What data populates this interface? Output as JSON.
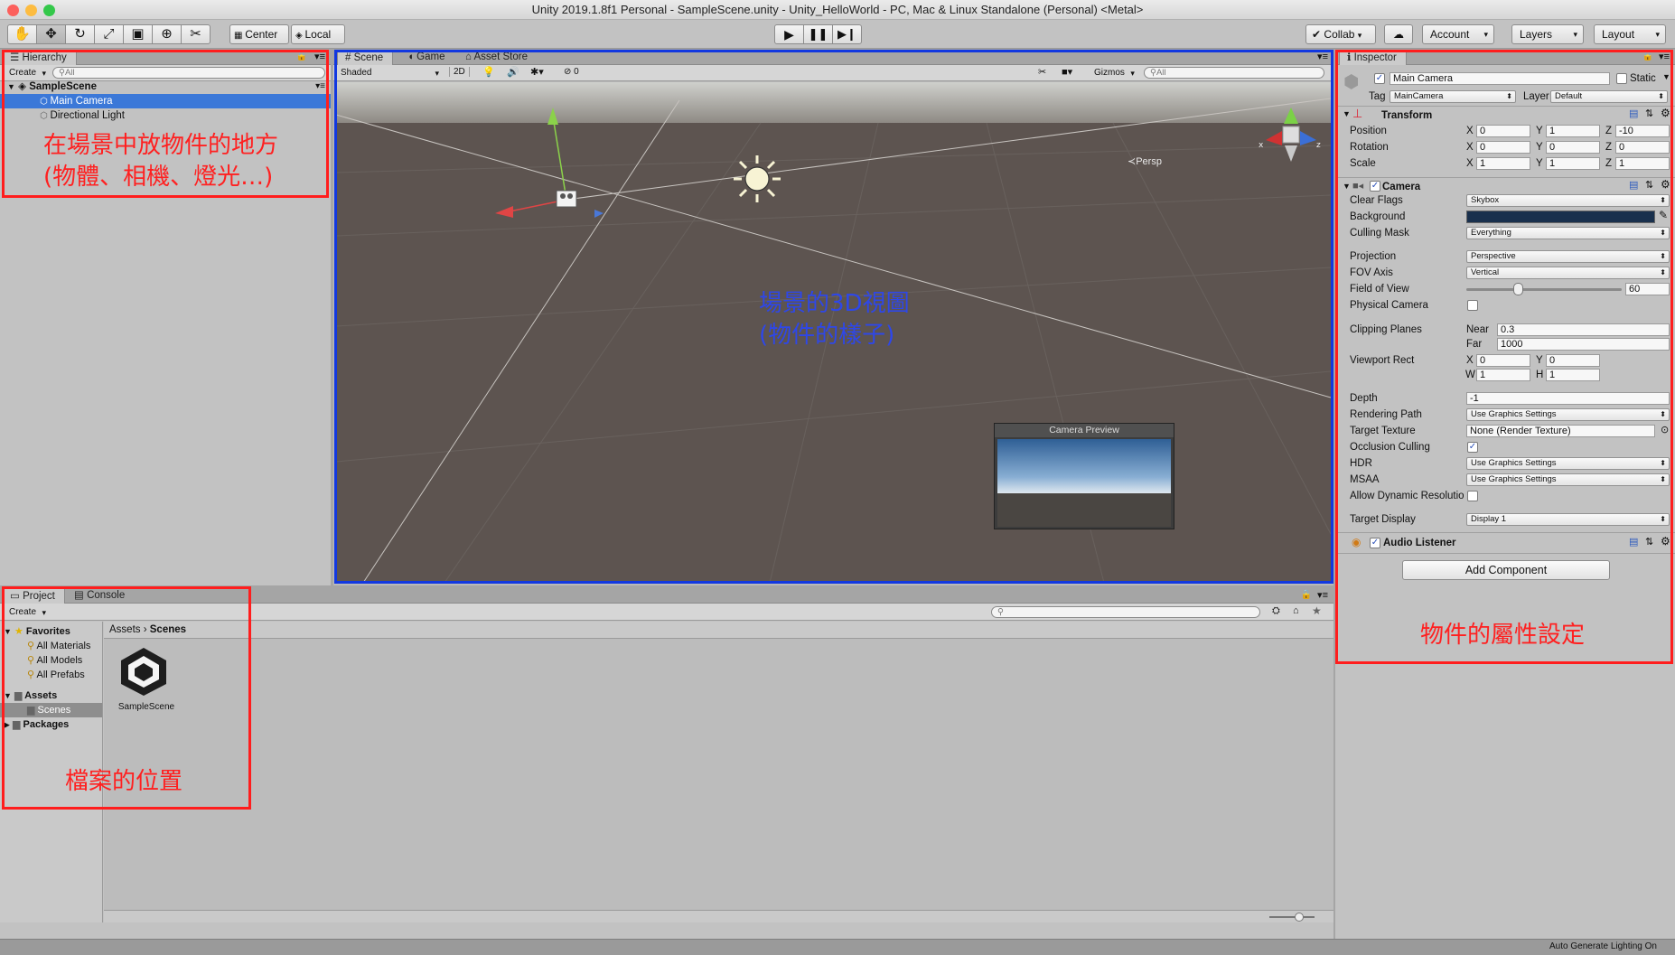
{
  "window": {
    "title": "Unity 2019.1.8f1 Personal - SampleScene.unity - Unity_HelloWorld - PC, Mac & Linux Standalone (Personal) <Metal>"
  },
  "toolbar": {
    "pivot_label": "Center",
    "space_label": "Local",
    "collab_label": "Collab",
    "account_label": "Account",
    "layers_label": "Layers",
    "layout_label": "Layout"
  },
  "hierarchy": {
    "tab_label": "Hierarchy",
    "create_label": "Create",
    "search_placeholder": "All",
    "scene_name": "SampleScene",
    "items": [
      {
        "label": "Main Camera"
      },
      {
        "label": "Directional Light"
      }
    ],
    "annotation_line1": "在場景中放物件的地方",
    "annotation_line2": "(物體、相機、燈光…)"
  },
  "scene": {
    "tabs": [
      {
        "label": "Scene"
      },
      {
        "label": "Game"
      },
      {
        "label": "Asset Store"
      }
    ],
    "shading_mode": "Shaded",
    "mode_2d": "2D",
    "hidden_count": "0",
    "gizmos_label": "Gizmos",
    "search_placeholder": "All",
    "persp_label": "Persp",
    "camera_preview_title": "Camera Preview",
    "annotation_line1": "場景的3D視圖",
    "annotation_line2": "(物件的樣子)",
    "colors": {
      "sky": "#8e8a84",
      "ground": "#5d5450"
    }
  },
  "inspector": {
    "tab_label": "Inspector",
    "object_name": "Main Camera",
    "static_label": "Static",
    "tag_label": "Tag",
    "tag_value": "MainCamera",
    "layer_label": "Layer",
    "layer_value": "Default",
    "transform": {
      "title": "Transform",
      "position_label": "Position",
      "rotation_label": "Rotation",
      "scale_label": "Scale",
      "position": {
        "x": "0",
        "y": "1",
        "z": "-10"
      },
      "rotation": {
        "x": "0",
        "y": "0",
        "z": "0"
      },
      "scale": {
        "x": "1",
        "y": "1",
        "z": "1"
      }
    },
    "camera": {
      "title": "Camera",
      "clear_flags_label": "Clear Flags",
      "clear_flags_value": "Skybox",
      "background_label": "Background",
      "background_color": "#19304d",
      "culling_mask_label": "Culling Mask",
      "culling_mask_value": "Everything",
      "projection_label": "Projection",
      "projection_value": "Perspective",
      "fov_axis_label": "FOV Axis",
      "fov_axis_value": "Vertical",
      "fov_label": "Field of View",
      "fov_value": "60",
      "fov_fraction": 0.33,
      "physical_camera_label": "Physical Camera",
      "clipping_label": "Clipping Planes",
      "near_label": "Near",
      "near_value": "0.3",
      "far_label": "Far",
      "far_value": "1000",
      "viewport_label": "Viewport Rect",
      "viewport": {
        "x": "0",
        "y": "0",
        "w": "1",
        "h": "1"
      },
      "depth_label": "Depth",
      "depth_value": "-1",
      "rendering_path_label": "Rendering Path",
      "rendering_path_value": "Use Graphics Settings",
      "target_texture_label": "Target Texture",
      "target_texture_value": "None (Render Texture)",
      "occlusion_label": "Occlusion Culling",
      "hdr_label": "HDR",
      "hdr_value": "Use Graphics Settings",
      "msaa_label": "MSAA",
      "msaa_value": "Use Graphics Settings",
      "dynamic_res_label": "Allow Dynamic Resolution",
      "target_display_label": "Target Display",
      "target_display_value": "Display 1"
    },
    "audio_listener_title": "Audio Listener",
    "add_component_label": "Add Component",
    "annotation": "物件的屬性設定"
  },
  "project": {
    "tabs": [
      {
        "label": "Project"
      },
      {
        "label": "Console"
      }
    ],
    "create_label": "Create",
    "favorites_label": "Favorites",
    "favorites": [
      {
        "label": "All Materials"
      },
      {
        "label": "All Models"
      },
      {
        "label": "All Prefabs"
      }
    ],
    "assets_label": "Assets",
    "scenes_label": "Scenes",
    "packages_label": "Packages",
    "breadcrumb_root": "Assets",
    "breadcrumb_current": "Scenes",
    "asset_item_label": "SampleScene",
    "annotation": "檔案的位置"
  },
  "statusbar": {
    "text": "Auto Generate Lighting On"
  }
}
